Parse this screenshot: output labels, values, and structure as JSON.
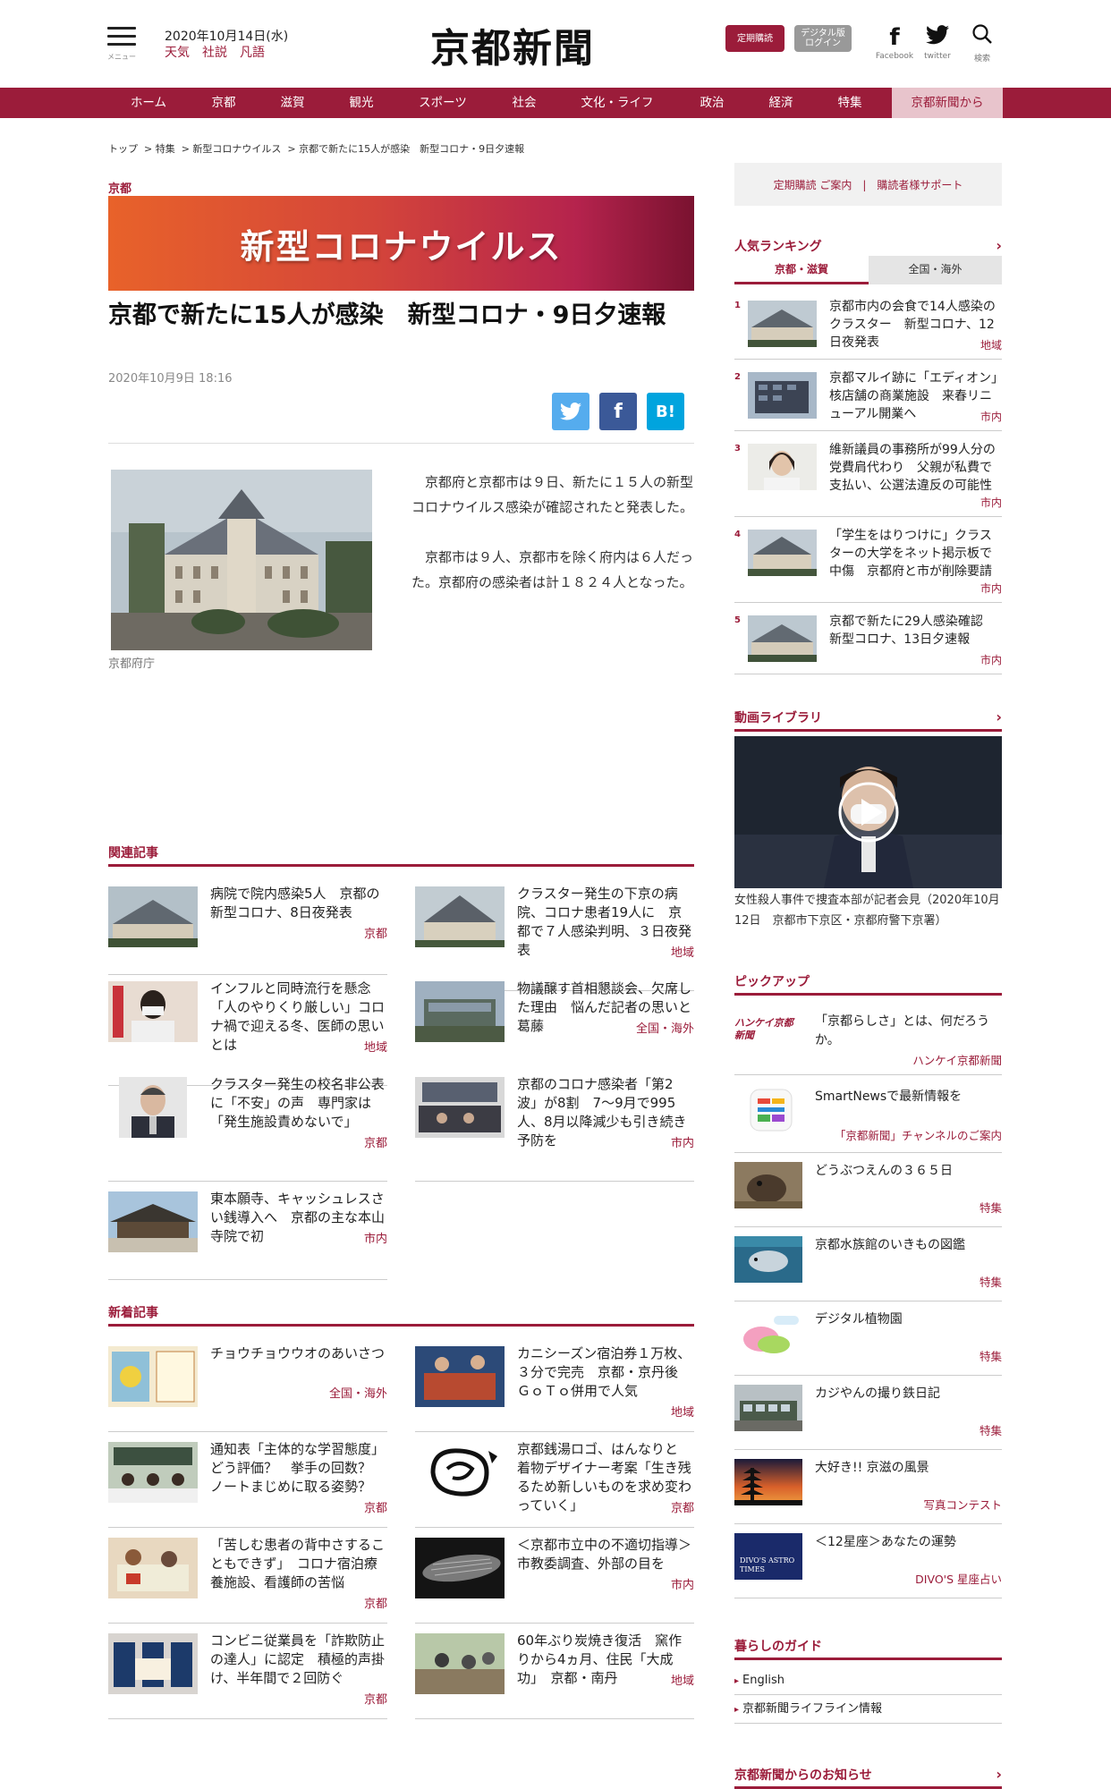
{
  "header": {
    "menu_label": "メニュー",
    "date": "2020年10月14日(水)",
    "links": [
      "天気",
      "社説",
      "凡語"
    ],
    "logo": "京都新聞",
    "subscribe_btn": "定期購読",
    "digital_btn": "デジタル版\nログイン",
    "facebook_label": "Facebook",
    "twitter_label": "twitter",
    "search_label": "検索"
  },
  "nav": [
    "ホーム",
    "京都",
    "滋賀",
    "観光",
    "スポーツ",
    "社会",
    "文化・ライフ",
    "政治",
    "経済",
    "特集",
    "京都新聞から"
  ],
  "breadcrumb": "トップ  > 特集  > 新型コロナウイルス  > 京都で新たに15人が感染　新型コロナ・9日夕速報",
  "article": {
    "region_tag": "京都",
    "banner": "新型コロナウイルス",
    "title": "京都で新たに15人が感染　新型コロナ・9日夕速報",
    "date": "2020年10月9日 18:16",
    "share": {
      "twitter": "twitter",
      "facebook": "f",
      "hatena": "B!"
    },
    "image_caption": "京都府庁",
    "body": [
      "京都府と京都市は９日、新たに１５人の新型コロナウイルス感染が確認されたと発表した。",
      "京都市は９人、京都市を除く府内は６人だった。京都府の感染者は計１８２４人となった。"
    ]
  },
  "related": {
    "heading": "関連記事",
    "items": [
      {
        "title": "病院で院内感染5人　京都の新型コロナ、8日夜発表",
        "category": "京都"
      },
      {
        "title": "クラスター発生の下京の病院、コロナ患者19人に　京都で７人感染判明、３日夜発表",
        "category": "地域"
      },
      {
        "title": "インフルと同時流行を懸念　「人のやりくり厳しい」コロナ禍で迎える冬、医師の思いとは",
        "category": "地域"
      },
      {
        "title": "物議醸す首相懇談会、欠席した理由　悩んだ記者の思いと葛藤",
        "category": "全国・海外"
      },
      {
        "title": "クラスター発生の校名非公表に「不安」の声　専門家は「発生施設責めないで」",
        "category": "京都"
      },
      {
        "title": "京都のコロナ感染者「第2波」が8割　7～9月で995人、8月以降減少も引き続き予防を",
        "category": "市内"
      },
      {
        "title": "東本願寺、キャッシュレスさい銭導入へ　京都の主な本山寺院で初",
        "category": "市内"
      }
    ]
  },
  "latest": {
    "heading": "新着記事",
    "items": [
      {
        "title": "チョウチョウウオのあいさつ",
        "category": "全国・海外"
      },
      {
        "title": "カニシーズン宿泊券１万枚、３分で完売　京都・京丹後　ＧｏＴｏ併用で人気",
        "category": "地域"
      },
      {
        "title": "通知表「主体的な学習態度」どう評価？　挙手の回数？　ノートまじめに取る姿勢？",
        "category": "京都"
      },
      {
        "title": "京都銭湯ロゴ、はんなりと　着物デザイナー考案「生き残るため新しいものを求め変わっていく」",
        "category": "京都"
      },
      {
        "title": "「苦しむ患者の背中さすることもできず」　コロナ宿泊療養施設、看護師の苦悩",
        "category": "京都"
      },
      {
        "title": "＜京都市立中の不適切指導＞市教委調査、外部の目を",
        "category": "市内"
      },
      {
        "title": "コンビニ従業員を「詐欺防止の達人」に認定　積極的声掛け、半年間で２回防ぐ",
        "category": "京都"
      },
      {
        "title": "60年ぶり炭焼き復活　窯作りから4ヵ月、住民「大成功」　京都・南丹",
        "category": "地域"
      }
    ]
  },
  "sidebar": {
    "top_box": "定期購読 ご案内　|　購読者様サポート",
    "ranking": {
      "heading": "人気ランキング",
      "tabs": [
        "京都・滋賀",
        "全国・海外"
      ],
      "items": [
        {
          "rank": "1",
          "title": "京都市内の会食で14人感染のクラスター　新型コロナ、12日夜発表",
          "category": "地域"
        },
        {
          "rank": "2",
          "title": "京都マルイ跡に「エディオン」核店舗の商業施設　来春リニューアル開業へ",
          "category": "市内"
        },
        {
          "rank": "3",
          "title": "維新議員の事務所が99人分の党費肩代わり　父親が私費で支払い、公選法違反の可能性",
          "category": "市内"
        },
        {
          "rank": "4",
          "title": "「学生をはりつけに」クラスターの大学をネット掲示板で中傷　京都府と市が削除要請",
          "category": "市内"
        },
        {
          "rank": "5",
          "title": "京都で新たに29人感染確認　新型コロナ、13日夕速報",
          "category": "市内"
        }
      ]
    },
    "video": {
      "heading": "動画ライブラリ",
      "caption": "女性殺人事件で捜査本部が記者会見（2020年10月12日　京都市下京区・京都府警下京署）"
    },
    "pickup": {
      "heading": "ピックアップ",
      "items": [
        {
          "title": "「京都らしさ」とは、何だろうか。",
          "sub": "ハンケイ京都新聞",
          "logo": "ハンケイ京都新聞"
        },
        {
          "title": "SmartNewsで最新情報を",
          "sub": "「京都新聞」チャンネルのご案内"
        },
        {
          "title": "どうぶつえんの３６５日",
          "sub": "特集"
        },
        {
          "title": "京都水族館のいきもの図鑑",
          "sub": "特集"
        },
        {
          "title": "デジタル植物園",
          "sub": "特集"
        },
        {
          "title": "カジやんの撮り鉄日記",
          "sub": "特集"
        },
        {
          "title": "大好き!! 京滋の風景",
          "sub": "写真コンテスト"
        },
        {
          "title": "＜12星座＞あなたの運勢",
          "sub": "DIVO'S 星座占い",
          "logo": "DIVO'S ASTRO TIMES"
        }
      ]
    },
    "guide": {
      "heading": "暮らしのガイド",
      "items": [
        "English",
        "京都新聞ライフライン情報"
      ]
    },
    "notice_heading": "京都新聞からのお知らせ"
  },
  "colors": {
    "brand": "#9b1c3a",
    "twitter": "#55acee",
    "facebook": "#3b5998",
    "hatena": "#00a4de"
  }
}
